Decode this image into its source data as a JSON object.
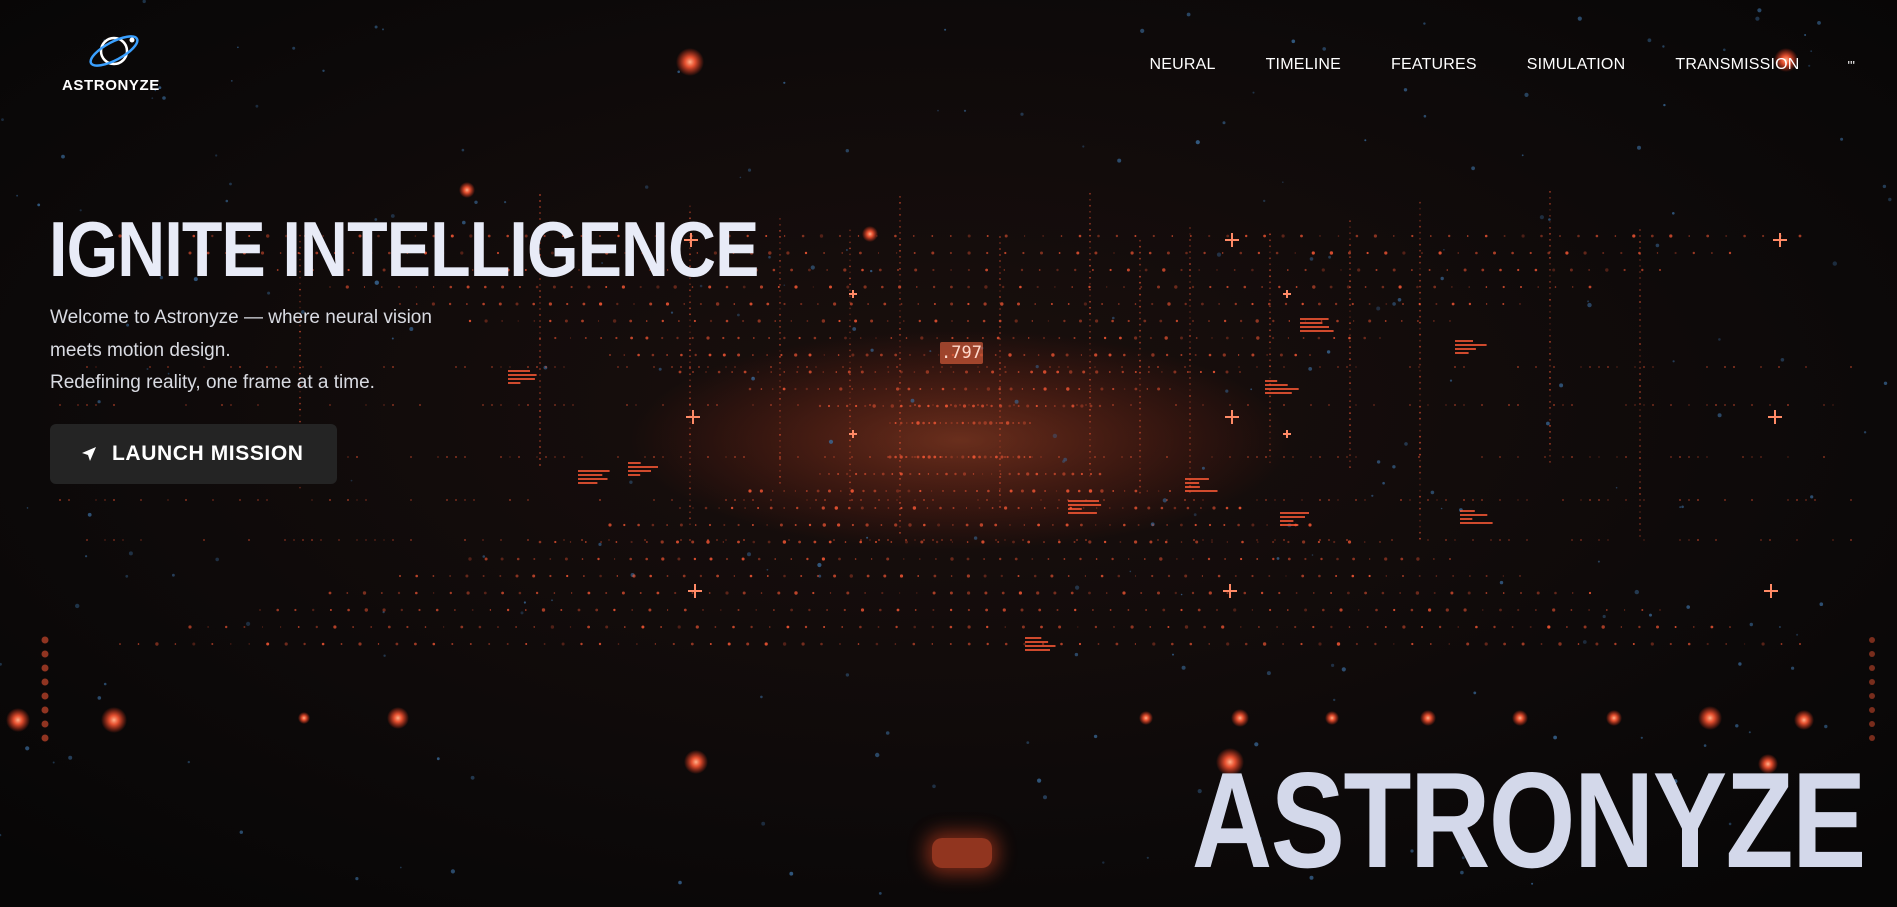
{
  "brand": {
    "logo_text": "ASTRONYZE",
    "logo_icon": "planet-orbit-icon"
  },
  "nav": {
    "items": [
      {
        "label": "NEURAL"
      },
      {
        "label": "TIMELINE"
      },
      {
        "label": "FEATURES"
      },
      {
        "label": "SIMULATION"
      },
      {
        "label": "TRANSMISSION"
      }
    ],
    "extra_label": "'''"
  },
  "hero": {
    "title": "IGNITE INTELLIGENCE",
    "lines": [
      "Welcome to Astronyze — where neural vision",
      "meets motion design.",
      "Redefining reality, one frame at a time."
    ],
    "cta_label": "LAUNCH MISSION",
    "cta_icon": "send-arrow-icon"
  },
  "scene": {
    "readout": ".797",
    "accent_color": "#ff5a36",
    "dot_color": "#3a6a9a"
  },
  "footer_brand": "ASTRONYZE"
}
